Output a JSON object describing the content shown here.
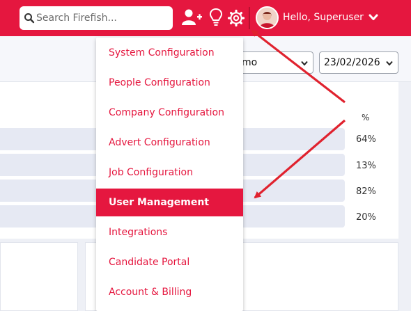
{
  "header": {
    "search_placeholder": "Search Firefish...",
    "icons": [
      "search-icon",
      "add-user-icon",
      "lightbulb-icon",
      "gear-icon",
      "avatar",
      "chevron-down-icon"
    ],
    "user_greeting": "Hello, Superuser"
  },
  "filters": {
    "select1_value": "mo",
    "date_value": "23/02/2026"
  },
  "stats": {
    "header": "%",
    "values": [
      "64%",
      "13%",
      "82%",
      "20%"
    ]
  },
  "settings_menu": {
    "items": [
      {
        "label": "System Configuration",
        "active": false
      },
      {
        "label": "People Configuration",
        "active": false
      },
      {
        "label": "Company Configuration",
        "active": false
      },
      {
        "label": "Advert Configuration",
        "active": false
      },
      {
        "label": "Job Configuration",
        "active": false
      },
      {
        "label": "User Management",
        "active": true
      },
      {
        "label": "Integrations",
        "active": false
      },
      {
        "label": "Candidate Portal",
        "active": false
      },
      {
        "label": "Account & Billing",
        "active": false
      }
    ]
  },
  "colors": {
    "brand": "#e5173f",
    "arrow": "#e0222e"
  }
}
